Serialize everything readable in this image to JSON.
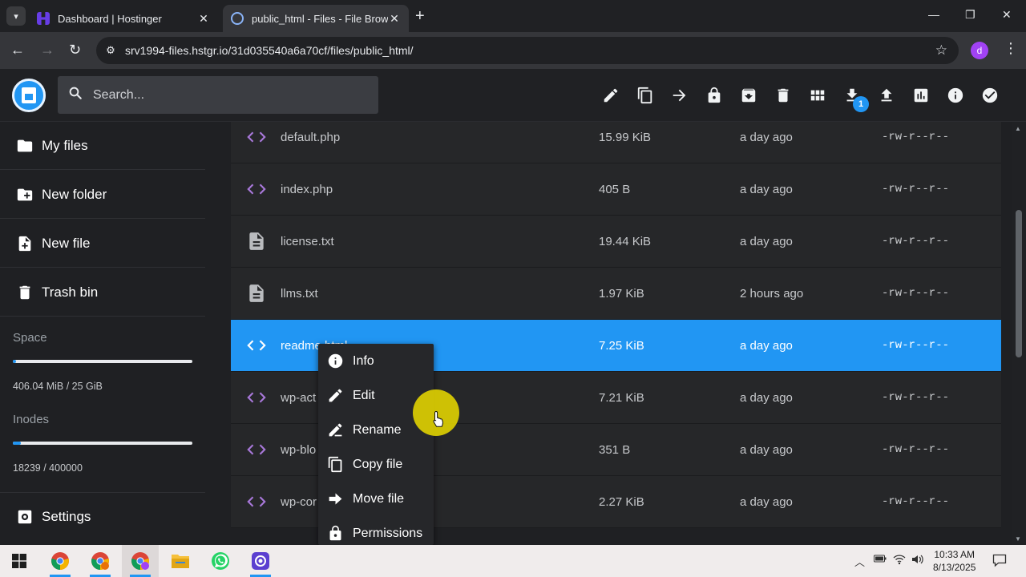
{
  "browser": {
    "tabs": [
      {
        "title": "Dashboard | Hostinger",
        "icon": "hostinger-icon"
      },
      {
        "title": "public_html - Files - File Browser",
        "icon": "globe-icon"
      }
    ],
    "url": "srv1994-files.hstgr.io/31d035540a6a70cf/files/public_html/",
    "profile_initial": "d"
  },
  "header": {
    "search_placeholder": "Search...",
    "download_count": "1"
  },
  "sidebar": {
    "items": [
      {
        "label": "My files",
        "icon": "folder-icon"
      },
      {
        "label": "New folder",
        "icon": "new-folder-icon"
      },
      {
        "label": "New file",
        "icon": "new-file-icon"
      },
      {
        "label": "Trash bin",
        "icon": "trash-icon"
      }
    ],
    "space": {
      "label": "Space",
      "text": "406.04 MiB / 25 GiB",
      "fraction": 0.016
    },
    "inodes": {
      "label": "Inodes",
      "text": "18239 / 400000",
      "fraction": 0.046
    },
    "settings_label": "Settings"
  },
  "files": [
    {
      "name": "default.php",
      "size": "15.99 KiB",
      "modified": "a day ago",
      "perm": "-rw-r--r--",
      "type": "code"
    },
    {
      "name": "index.php",
      "size": "405 B",
      "modified": "a day ago",
      "perm": "-rw-r--r--",
      "type": "code"
    },
    {
      "name": "license.txt",
      "size": "19.44 KiB",
      "modified": "a day ago",
      "perm": "-rw-r--r--",
      "type": "text"
    },
    {
      "name": "llms.txt",
      "size": "1.97 KiB",
      "modified": "2 hours ago",
      "perm": "-rw-r--r--",
      "type": "text"
    },
    {
      "name": "readme.html",
      "size": "7.25 KiB",
      "modified": "a day ago",
      "perm": "-rw-r--r--",
      "type": "code",
      "selected": true
    },
    {
      "name": "wp-act",
      "size": "7.21 KiB",
      "modified": "a day ago",
      "perm": "-rw-r--r--",
      "type": "code"
    },
    {
      "name": "wp-blo",
      "size": "351 B",
      "modified": "a day ago",
      "perm": "-rw-r--r--",
      "type": "code"
    },
    {
      "name": "wp-cor",
      "size": "2.27 KiB",
      "modified": "a day ago",
      "perm": "-rw-r--r--",
      "type": "code"
    }
  ],
  "context_menu": [
    {
      "label": "Info",
      "icon": "info-icon"
    },
    {
      "label": "Edit",
      "icon": "pencil-icon"
    },
    {
      "label": "Rename",
      "icon": "rename-icon"
    },
    {
      "label": "Copy file",
      "icon": "copy-icon"
    },
    {
      "label": "Move file",
      "icon": "move-icon"
    },
    {
      "label": "Permissions",
      "icon": "lock-icon"
    }
  ],
  "taskbar": {
    "time": "10:33 AM",
    "date": "8/13/2025"
  },
  "colors": {
    "accent": "#2196f3",
    "code_icon": "#a878d9",
    "highlight": "#e6d700"
  }
}
